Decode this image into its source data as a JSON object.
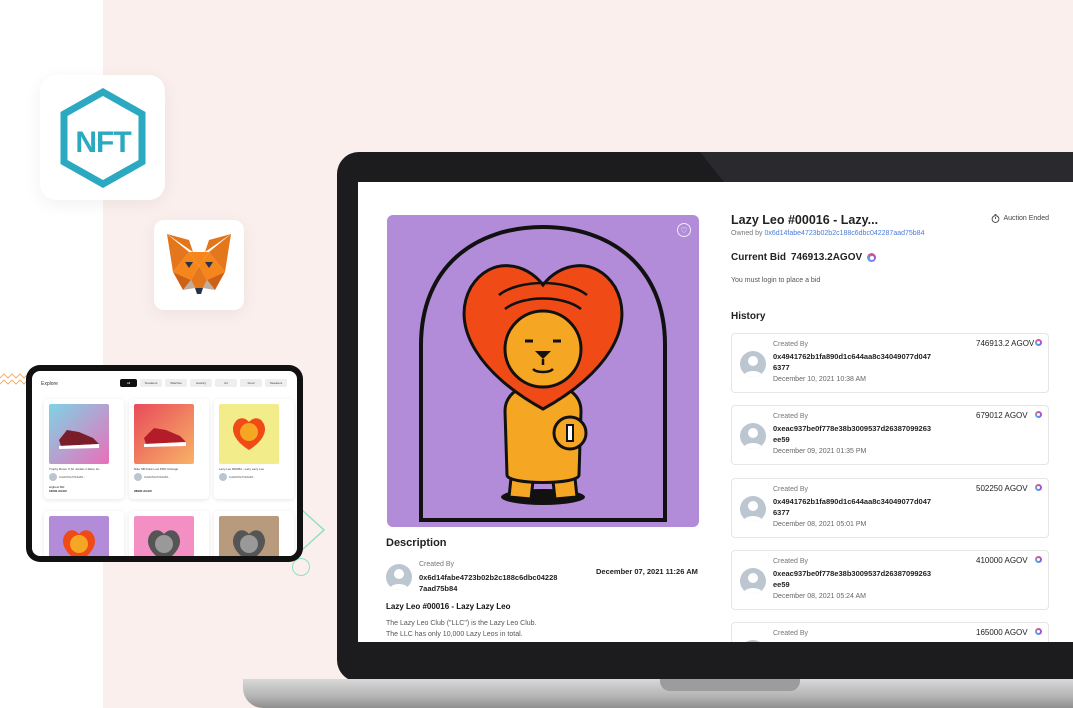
{
  "nft_logo_text": "NFT",
  "tablet": {
    "title": "Explore",
    "filters": [
      "All",
      "Sneakers",
      "Watches",
      "Jewelry",
      "Art",
      "Food",
      "Sweaters"
    ],
    "cards": [
      {
        "caption": "Trophy Room X Air Jordan 1 Retro Hi...",
        "address": "0x4a5c65e7b3b4af84...",
        "price_label": "Highest Bid",
        "price": "16000 AGOV",
        "art": "#7fd3e6"
      },
      {
        "caption": "Nike SB Dunk Low PRO Chicago",
        "address": "0x4a5c65e7b3b4af84...",
        "price_label": "",
        "price": "28900 AGOV",
        "art": "#e94b5a"
      },
      {
        "caption": "Lazy Leo #00052 - Lazy Lazy Leo",
        "address": "0x4a5c65e7b3b4af84...",
        "price_label": "",
        "price": "",
        "art": "#f3ec8a"
      }
    ]
  },
  "detail": {
    "title": "Lazy Leo #00016 - Lazy...",
    "owned_prefix": "Owned by ",
    "owner": "0x6d14fabe4723b02b2c188c6dbc042287aad75b84",
    "auction_status": "Auction Ended",
    "bid_label": "Current Bid",
    "bid_value": "746913.2AGOV",
    "login_note": "You must login to place a bid",
    "history_title": "History",
    "history": [
      {
        "label": "Created By",
        "address": "0x4941762b1fa890d1c644aa8c34049077d0476377",
        "date": "December 10, 2021 10:38 AM",
        "amount": "746913.2 AGOV"
      },
      {
        "label": "Created By",
        "address": "0xeac937be0f778e38b3009537d26387099263ee59",
        "date": "December 09, 2021 01:35 PM",
        "amount": "679012 AGOV"
      },
      {
        "label": "Created By",
        "address": "0x4941762b1fa890d1c644aa8c34049077d0476377",
        "date": "December 08, 2021 05:01 PM",
        "amount": "502250 AGOV"
      },
      {
        "label": "Created By",
        "address": "0xeac937be0f778e38b3009537d26387099263ee59",
        "date": "December 08, 2021 05:24 AM",
        "amount": "410000 AGOV"
      },
      {
        "label": "Created By",
        "address": "",
        "date": "",
        "amount": "165000 AGOV"
      }
    ],
    "description_title": "Description",
    "creator_label": "Created By",
    "creator_address": "0x6d14fabe4723b02b2c188c6dbc042287aad75b84",
    "created_date": "December 07, 2021 11:26 AM",
    "nft_name": "Lazy Leo #00016 - Lazy Lazy Leo",
    "desc_line1": "The Lazy Leo Club (\"LLC\") is the Lazy Leo Club.",
    "desc_line2": "The LLC has only 10,000 Lazy Leos in total."
  },
  "colors": {
    "accent": "#4a7bd8",
    "art_bg": "#b38cd9",
    "mane": "#f04a16",
    "body": "#f5a623",
    "page_bg": "#fbefee",
    "nft_teal": "#2aa9c0"
  }
}
